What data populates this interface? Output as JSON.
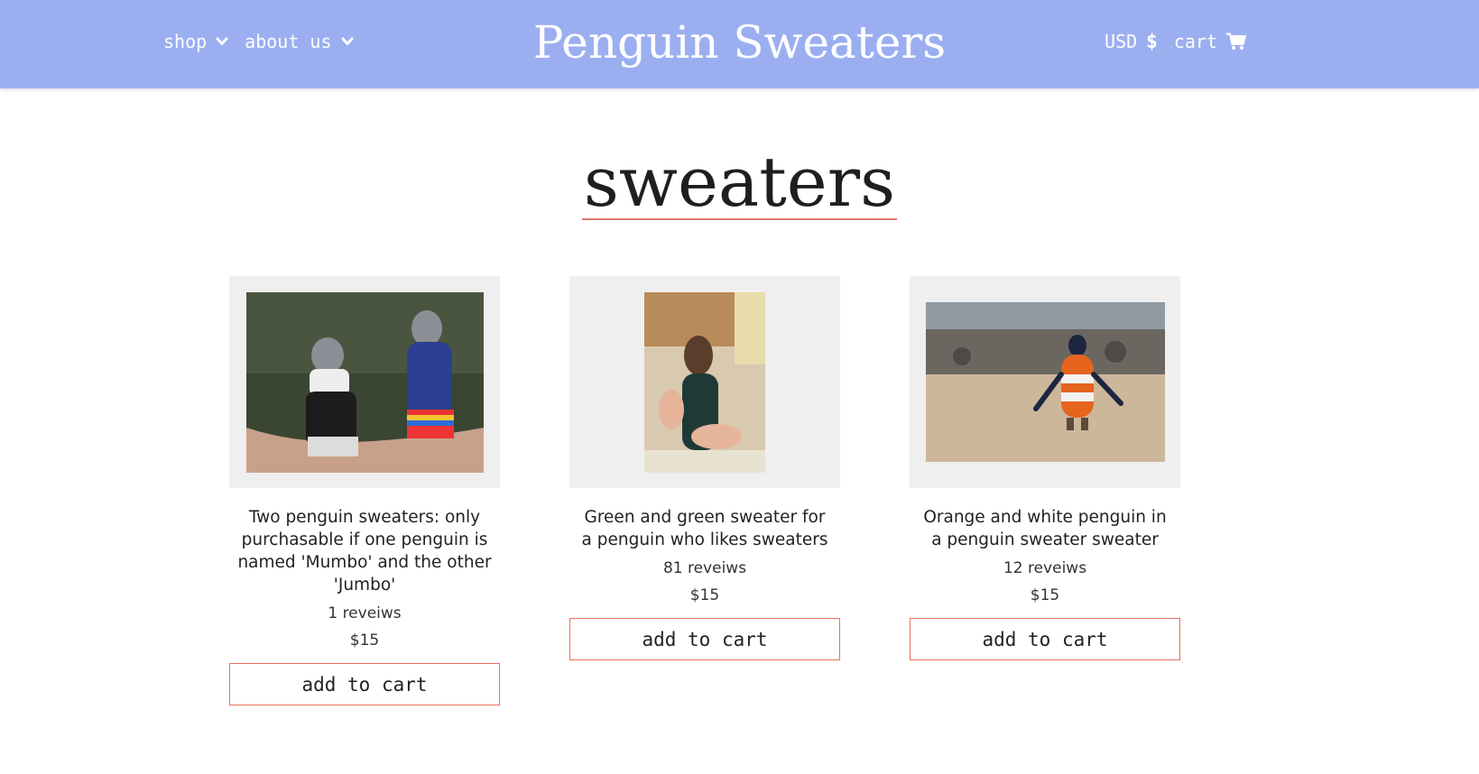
{
  "header": {
    "brand": "Penguin Sweaters",
    "nav": [
      {
        "label": "shop",
        "icon": "chevron-down-icon"
      },
      {
        "label": "about us",
        "icon": "chevron-down-icon"
      }
    ],
    "currency": {
      "label": "USD",
      "symbol": "$"
    },
    "cart": {
      "label": "cart",
      "icon": "cart-icon"
    },
    "background": "#9baff0"
  },
  "page": {
    "heading": "sweaters",
    "underline_color": "#e07b70"
  },
  "products": [
    {
      "title": "Two penguin sweaters: only purchasable if one penguin is named 'Mumbo' and the other 'Jumbo'",
      "reviews": "1 reveiws",
      "price": "$15",
      "button": "add to cart",
      "image": "two-penguins-in-knitted-sweaters"
    },
    {
      "title": "Green and green sweater for a penguin who likes sweaters",
      "reviews": "81 reveiws",
      "price": "$15",
      "button": "add to cart",
      "image": "penguin-in-green-sweater"
    },
    {
      "title": "Orange and white penguin in a penguin sweater sweater",
      "reviews": "12 reveiws",
      "price": "$15",
      "button": "add to cart",
      "image": "penguin-in-orange-sweater-on-beach"
    }
  ],
  "colors": {
    "button_border": "#e8705f",
    "image_bg": "#efefef"
  }
}
